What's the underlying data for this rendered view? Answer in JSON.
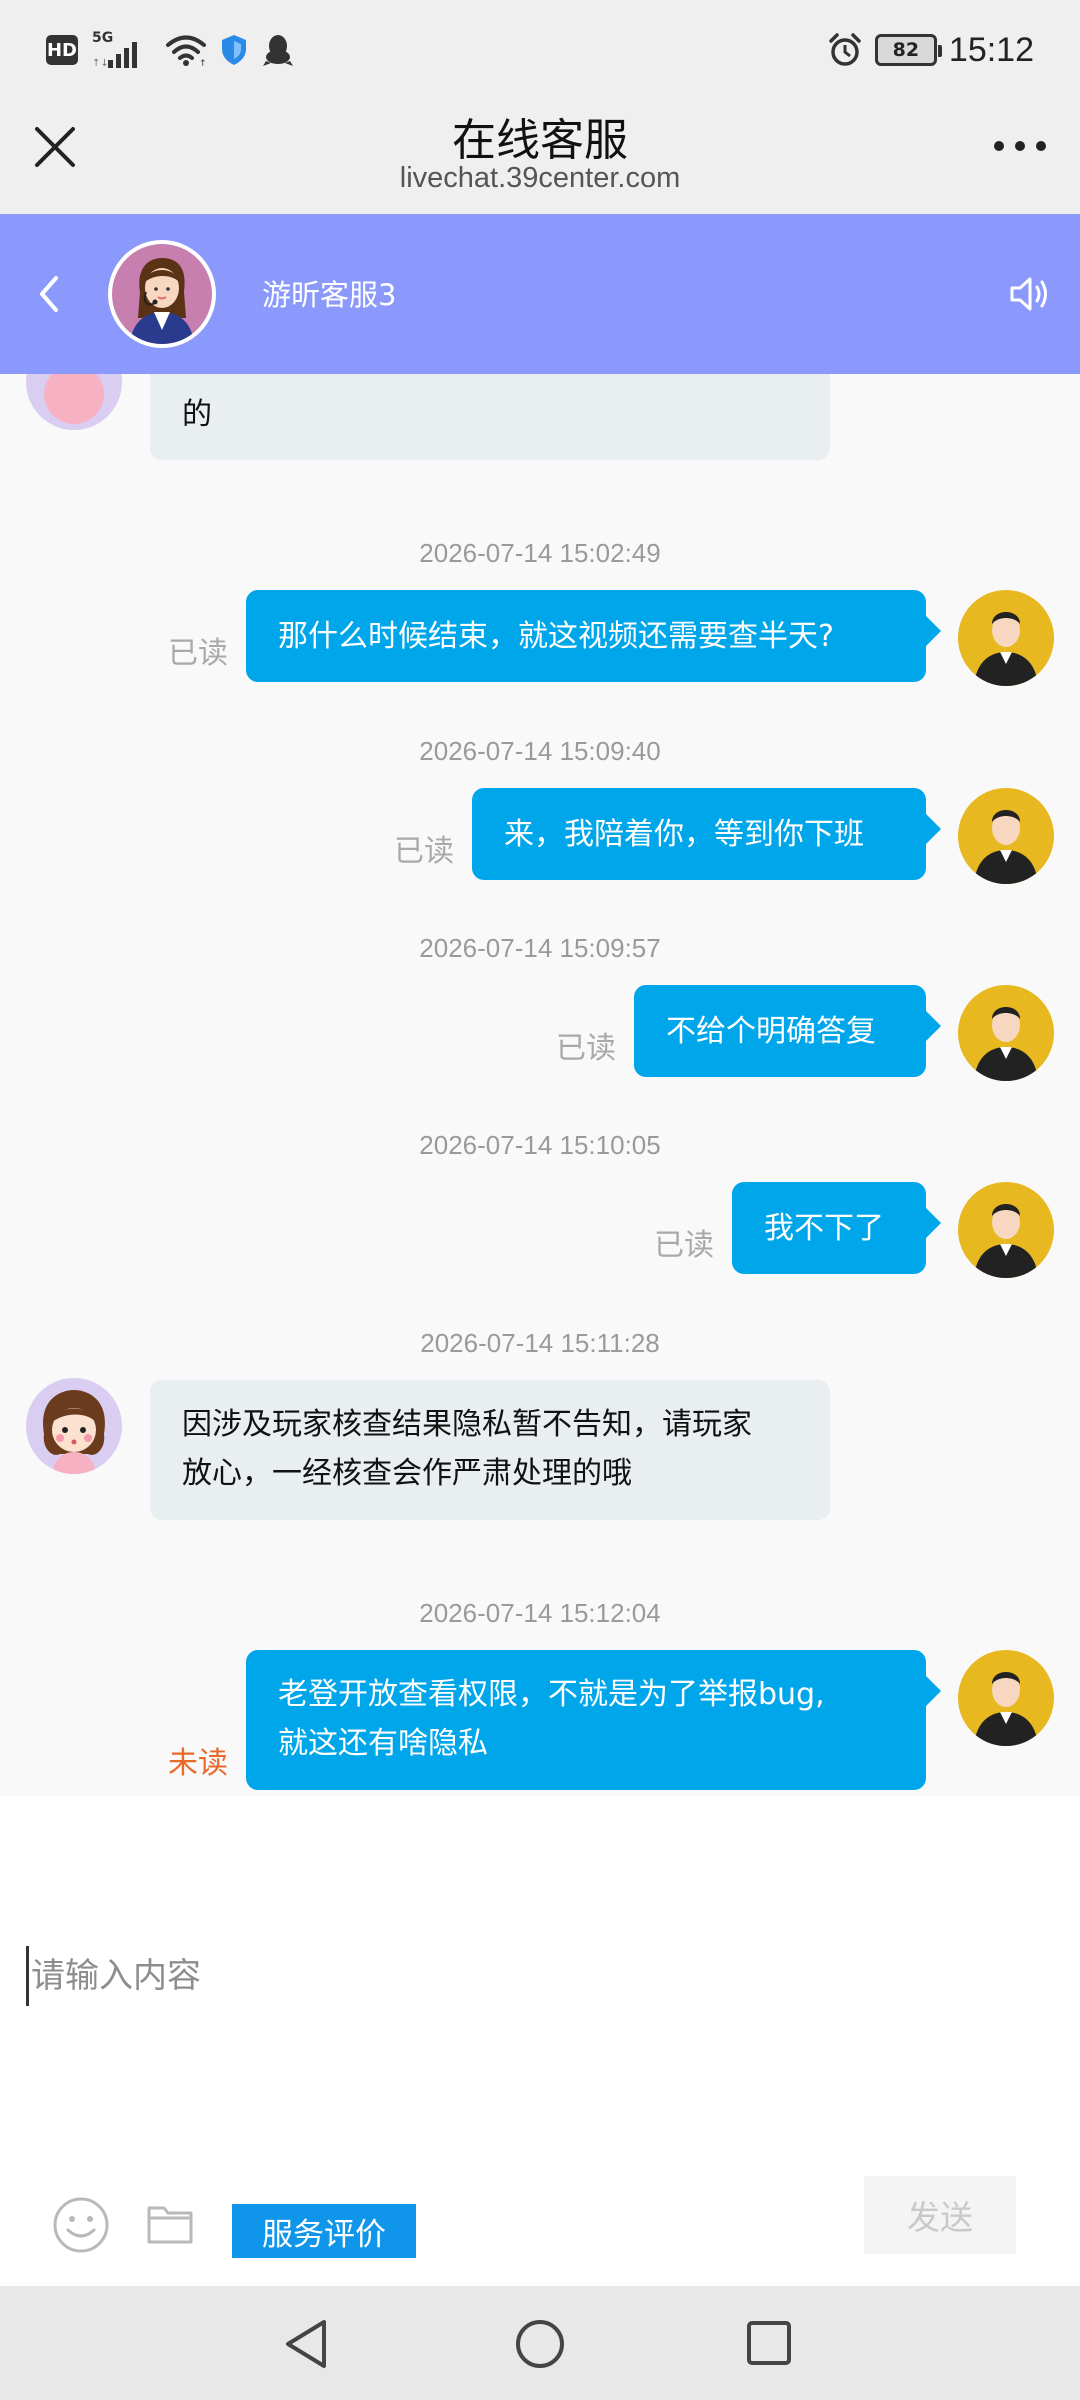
{
  "status_bar": {
    "hd_label": "HD",
    "network_label": "5G",
    "battery": "82",
    "time": "15:12",
    "icons": [
      "wifi-icon",
      "shield-icon",
      "qq-icon",
      "alarm-icon"
    ]
  },
  "title_bar": {
    "title": "在线客服",
    "subtitle": "livechat.39center.com",
    "close_icon": "close-icon",
    "more_icon": "more-icon"
  },
  "chat_header": {
    "agent_name": "游昕客服3",
    "accent_color": "#8b99fc"
  },
  "messages": [
    {
      "id": "m0",
      "side": "in",
      "text": "的"
    },
    {
      "id": "m1",
      "timestamp": "2026-07-14 15:02:49",
      "side": "out",
      "text": "那什么时候结束，就这视频还需要查半天?",
      "status": "已读"
    },
    {
      "id": "m2",
      "timestamp": "2026-07-14 15:09:40",
      "side": "out",
      "text": "来，我陪着你，等到你下班",
      "status": "已读"
    },
    {
      "id": "m3",
      "timestamp": "2026-07-14 15:09:57",
      "side": "out",
      "text": "不给个明确答复",
      "status": "已读"
    },
    {
      "id": "m4",
      "timestamp": "2026-07-14 15:10:05",
      "side": "out",
      "text": "我不下了",
      "status": "已读"
    },
    {
      "id": "m5",
      "timestamp": "2026-07-14 15:11:28",
      "side": "in",
      "lines": [
        "因涉及玩家核查结果隐私暂不告知，请玩家",
        "放心，一经核查会作严肃处理的哦"
      ]
    },
    {
      "id": "m6",
      "timestamp": "2026-07-14 15:12:04",
      "side": "out",
      "lines": [
        "老登开放查看权限，不就是为了举报bug,",
        "就这还有啥隐私"
      ],
      "status": "未读"
    }
  ],
  "colors": {
    "outgoing_bubble": "#00a6ea",
    "incoming_bubble": "#e9eef0",
    "read_status": "#a9a9a9",
    "unread_status": "#e8692a"
  },
  "composer": {
    "placeholder": "请输入内容",
    "value": "",
    "rate_label": "服务评价",
    "send_label": "发送"
  }
}
